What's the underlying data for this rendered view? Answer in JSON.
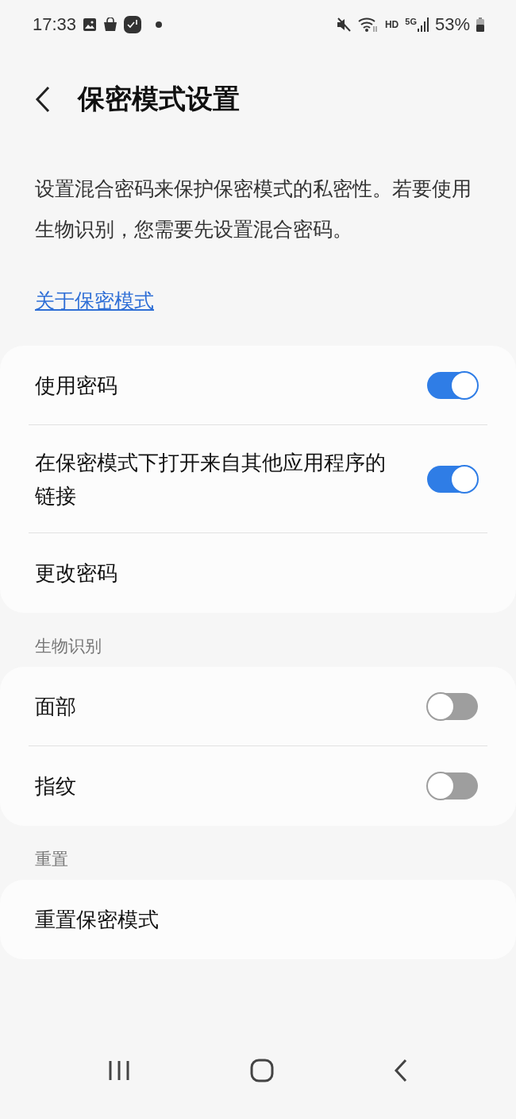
{
  "status_bar": {
    "time": "17:33",
    "network": "HD",
    "signal_type": "5G",
    "battery": "53%"
  },
  "header": {
    "title": "保密模式设置"
  },
  "description": "设置混合密码来保护保密模式的私密性。若要使用生物识别，您需要先设置混合密码。",
  "about_link": "关于保密模式",
  "sections": [
    {
      "items": [
        {
          "kind": "toggle",
          "label": "使用密码",
          "on": true
        },
        {
          "kind": "toggle",
          "label": "在保密模式下打开来自其他应用程序的链接",
          "on": true
        },
        {
          "kind": "link",
          "label": "更改密码"
        }
      ]
    },
    {
      "heading": "生物识别",
      "items": [
        {
          "kind": "toggle",
          "label": "面部",
          "on": false
        },
        {
          "kind": "toggle",
          "label": "指纹",
          "on": false
        }
      ]
    },
    {
      "heading": "重置",
      "items": [
        {
          "kind": "link",
          "label": "重置保密模式"
        }
      ]
    }
  ]
}
